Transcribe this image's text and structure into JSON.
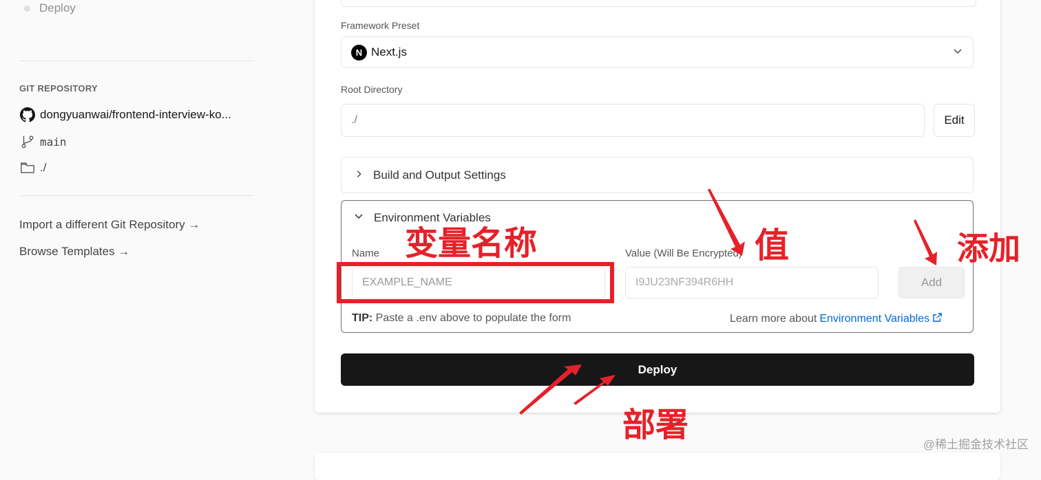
{
  "sidebar": {
    "step_label": "Deploy",
    "git_section_title": "GIT REPOSITORY",
    "repo_name": "dongyuanwai/frontend-interview-ko...",
    "branch": "main",
    "directory": "./",
    "import_link": "Import a different Git Repository →",
    "templates_link": "Browse Templates →"
  },
  "form": {
    "framework_label": "Framework Preset",
    "framework_value": "Next.js",
    "framework_logo": "N",
    "root_dir_label": "Root Directory",
    "root_dir_value": "./",
    "edit_button": "Edit",
    "build_settings": "Build and Output Settings",
    "env": {
      "title": "Environment Variables",
      "name_label": "Name",
      "name_placeholder": "EXAMPLE_NAME",
      "value_label": "Value (Will Be Encrypted)",
      "value_placeholder": "I9JU23NF394R6HH",
      "add_button": "Add",
      "tip_bold": "TIP:",
      "tip_text": " Paste a .env above to populate the form",
      "learn_prefix": "Learn more about",
      "learn_link": "Environment Variables"
    },
    "deploy_button": "Deploy"
  },
  "annotations": {
    "name_note": "变量名称",
    "value_note": "值",
    "add_note": "添加",
    "deploy_note": "部署",
    "color": "#e62129"
  },
  "watermark": "@稀土掘金技术社区",
  "icons": [
    "github-icon",
    "branch-icon",
    "folder-icon",
    "chevron-down-icon",
    "chevron-right-icon",
    "external-link-icon"
  ]
}
